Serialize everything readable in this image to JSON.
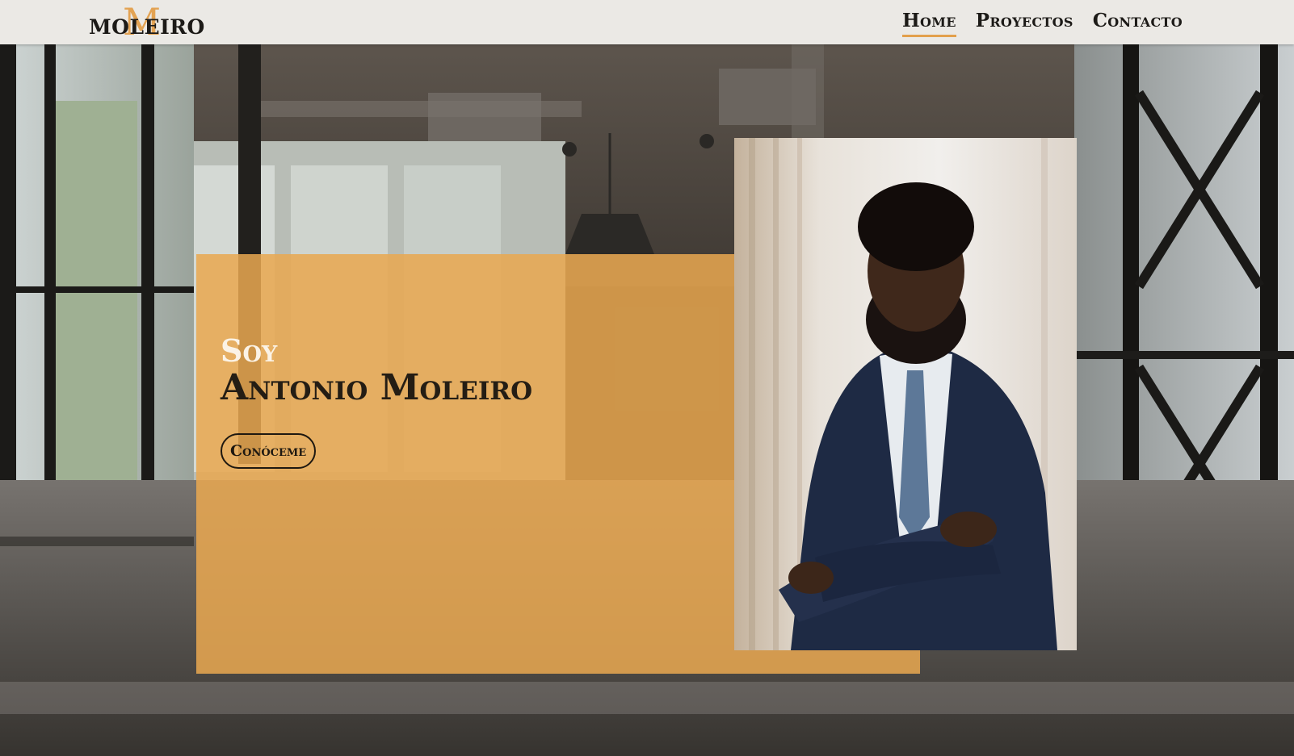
{
  "header": {
    "logo": {
      "initial": "M",
      "text": "MOLEIRO"
    },
    "nav": [
      {
        "label": "Home",
        "active": true
      },
      {
        "label": "Proyectos",
        "active": false
      },
      {
        "label": "Contacto",
        "active": false
      }
    ]
  },
  "hero": {
    "greeting": "Soy",
    "name": "Antonio Moleiro",
    "cta_label": "Conóceme"
  },
  "colors": {
    "accent": "#e3a04c",
    "header_bg": "#ebe9e5",
    "text_dark": "#1c1a17",
    "greeting_text": "#fbf3e6"
  },
  "images": {
    "background": "office-interior-photo",
    "portrait": "man-in-suit-arms-crossed-photo"
  }
}
